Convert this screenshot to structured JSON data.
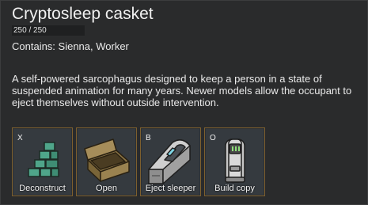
{
  "inspect": {
    "title": "Cryptosleep casket",
    "hit_points": "250 / 250",
    "hit_points_fraction": 1.0,
    "contains": "Contains: Sienna, Worker",
    "description": "A self-powered sarcophagus designed to keep a person in a state of suspended animation for many years. Newer models allow the occupant to eject themselves without outside intervention."
  },
  "gizmos": [
    {
      "label": "Deconstruct",
      "hotkey": "X",
      "icon": "deconstruct-bricks-icon"
    },
    {
      "label": "Open",
      "hotkey": "",
      "icon": "open-box-icon"
    },
    {
      "label": "Eject sleeper",
      "hotkey": "B",
      "icon": "casket-icon"
    },
    {
      "label": "Build copy",
      "hotkey": "O",
      "icon": "cryptosleep-pod-icon"
    }
  ],
  "colors": {
    "panel_bg": "#2a2b2c",
    "gizmo_bg": "#353a3f",
    "gizmo_border": "#7d5f2e"
  }
}
